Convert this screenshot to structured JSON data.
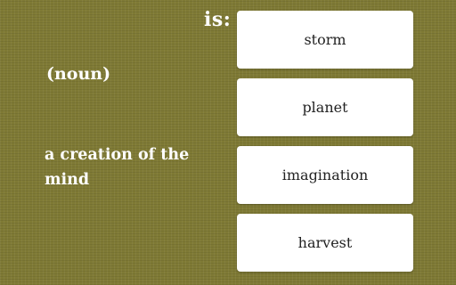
{
  "quiz": {
    "prompt_label": "is:",
    "part_of_speech": "(noun)",
    "definition": "a creation of the mind",
    "options": [
      {
        "label": "storm"
      },
      {
        "label": "planet"
      },
      {
        "label": "imagination"
      },
      {
        "label": "harvest"
      }
    ]
  },
  "colors": {
    "background": "#7f7a35",
    "card": "#ffffff",
    "text_light": "#ffffff",
    "text_dark": "#222222"
  }
}
